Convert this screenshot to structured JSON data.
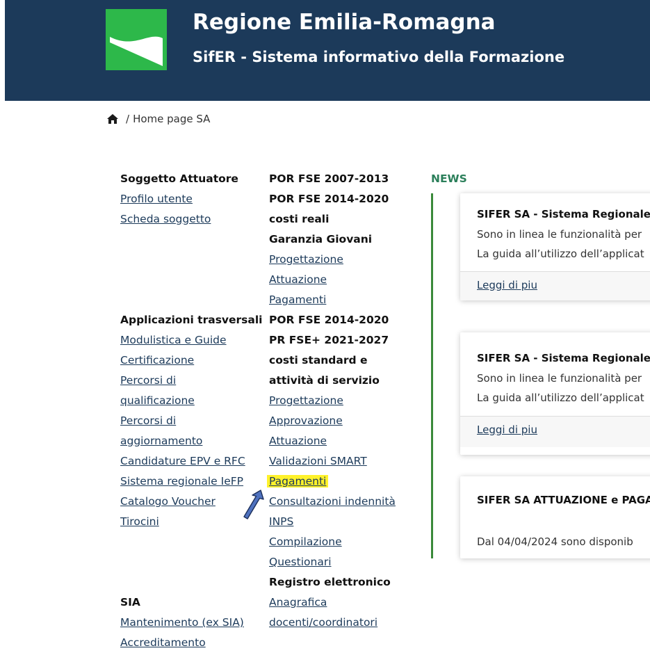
{
  "header": {
    "title": "Regione Emilia-Romagna",
    "subtitle": "SifER - Sistema informativo della Formazione"
  },
  "breadcrumb": {
    "separator": "/",
    "current": "Home page SA"
  },
  "col1": {
    "g1_head": "Soggetto Attuatore",
    "g1_links": [
      "Profilo utente",
      "Scheda soggetto"
    ],
    "g2_head": "Applicazioni trasversali",
    "g2_links": [
      "Modulistica e Guide",
      "Certificazione",
      "Percorsi di",
      "qualificazione",
      "Percorsi di",
      "aggiornamento",
      "Candidature EPV e RFC",
      "Sistema regionale IeFP",
      "Catalogo Voucher",
      "Tirocini"
    ],
    "g3_head": "SIA",
    "g3_links": [
      "Mantenimento (ex SIA)",
      "Accreditamento"
    ]
  },
  "col2": {
    "g1_heads": [
      "POR FSE 2007-2013",
      "POR FSE 2014-2020",
      "costi reali",
      "Garanzia Giovani"
    ],
    "g1_links": [
      "Progettazione",
      "Attuazione",
      "Pagamenti"
    ],
    "g2_heads": [
      "POR FSE 2014-2020",
      "PR FSE+ 2021-2027",
      "costi standard e",
      "attività di servizio"
    ],
    "g2_links": [
      "Progettazione",
      "Approvazione",
      "Attuazione",
      "Validazioni SMART",
      "Pagamenti",
      "Consultazioni indennità",
      "INPS",
      "Compilazione",
      "Questionari"
    ],
    "g3_head": "Registro elettronico",
    "g3_links": [
      "Anagrafica",
      "docenti/coordinatori"
    ]
  },
  "news": {
    "title": "NEWS",
    "cards": [
      {
        "title": "SIFER SA - Sistema Regionale",
        "line1": "Sono in linea le funzionalità per",
        "line2": "La guida all’utilizzo dell’applicat",
        "link": "Leggi di piu"
      },
      {
        "title": "SIFER SA - Sistema Regionale",
        "line1": "Sono in linea le funzionalità per",
        "line2": "La guida all’utilizzo dell’applicat",
        "link": "Leggi di piu"
      },
      {
        "title": "SIFER SA ATTUAZIONE e PAGA",
        "line1": "Dal 04/04/2024 sono disponib"
      }
    ]
  },
  "colors": {
    "header_bg": "#1c3a5a",
    "logo_green": "#2db84a",
    "news_green": "#2b7f5a",
    "highlight": "#fff22b",
    "link": "#1c3a5a"
  }
}
